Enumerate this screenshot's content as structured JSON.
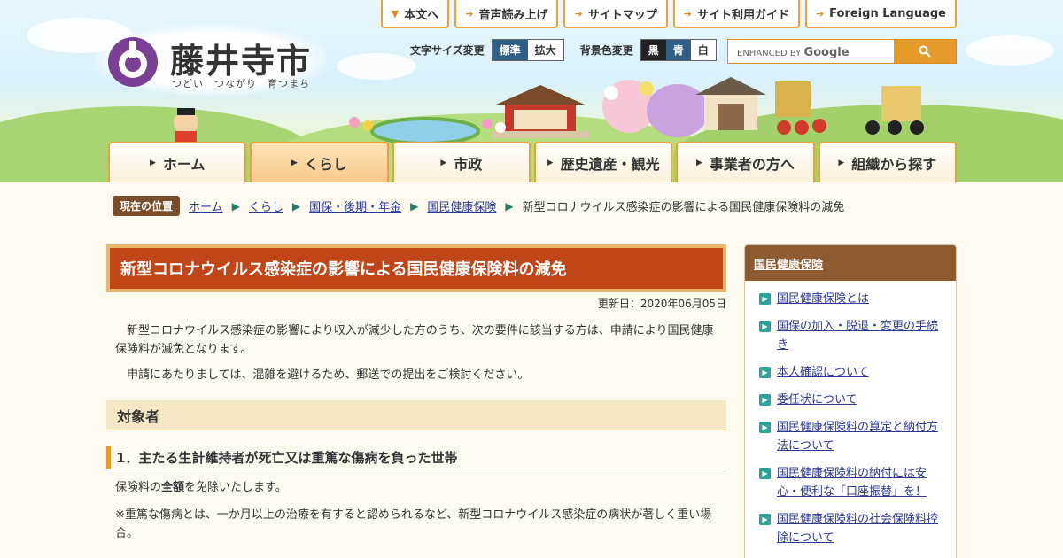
{
  "site": {
    "name": "藤井寺市",
    "tagline": "つどい　つながり　育つまち"
  },
  "utility_links": [
    {
      "label": "本文へ"
    },
    {
      "label": "音声読み上げ"
    },
    {
      "label": "サイトマップ"
    },
    {
      "label": "サイト利用ガイド"
    },
    {
      "label": "Foreign Language"
    }
  ],
  "settings": {
    "font_size_label": "文字サイズ変更",
    "font_size_options": [
      "標準",
      "拡大"
    ],
    "bg_color_label": "背景色変更",
    "bg_color_options": [
      "黒",
      "青",
      "白"
    ]
  },
  "search": {
    "placeholder_prefix": "ENHANCED BY",
    "placeholder_brand": "Google"
  },
  "nav": [
    {
      "label": "ホーム",
      "active": false
    },
    {
      "label": "くらし",
      "active": true
    },
    {
      "label": "市政",
      "active": false
    },
    {
      "label": "歴史遺産・観光",
      "active": false
    },
    {
      "label": "事業者の方へ",
      "active": false
    },
    {
      "label": "組織から探す",
      "active": false
    }
  ],
  "breadcrumb": {
    "here_label": "現在の位置",
    "items": [
      "ホーム",
      "くらし",
      "国保・後期・年金",
      "国民健康保険"
    ],
    "current": "新型コロナウイルス感染症の影響による国民健康保険料の減免"
  },
  "article": {
    "title": "新型コロナウイルス感染症の影響による国民健康保険料の減免",
    "updated": "更新日：2020年06月05日",
    "intro_1": "新型コロナウイルス感染症の影響により収入が減少した方のうち、次の要件に該当する方は、申請により国民健康保険料が減免となります。",
    "intro_2": "申請にあたりましては、混雑を避けるため、郵送での提出をご検討ください。",
    "section_1": "対象者",
    "subsection_1": "1．主たる生計維持者が死亡又は重篤な傷病を負った世帯",
    "body_1_pre": "保険料の",
    "body_1_bold": "全額",
    "body_1_post": "を免除いたします。",
    "note_1": "※重篤な傷病とは、一か月以上の治療を有すると認められるなど、新型コロナウイルス感染症の病状が著しく重い場合。"
  },
  "sidebar": {
    "heading": "国民健康保険",
    "links": [
      "国民健康保険とは",
      "国保の加入・脱退・変更の手続き",
      "本人確認について",
      "委任状について",
      "国民健康保険料の算定と納付方法について",
      "国民健康保険料の納付には安心・便利な「口座振替」を！",
      "国民健康保険料の社会保険料控除について"
    ]
  },
  "colors": {
    "accent_orange": "#e9a23a",
    "title_bg": "#c0461a",
    "side_head_bg": "#8d5a32",
    "link_blue": "#2a3a9a",
    "logo_purple": "#7b3f95"
  }
}
